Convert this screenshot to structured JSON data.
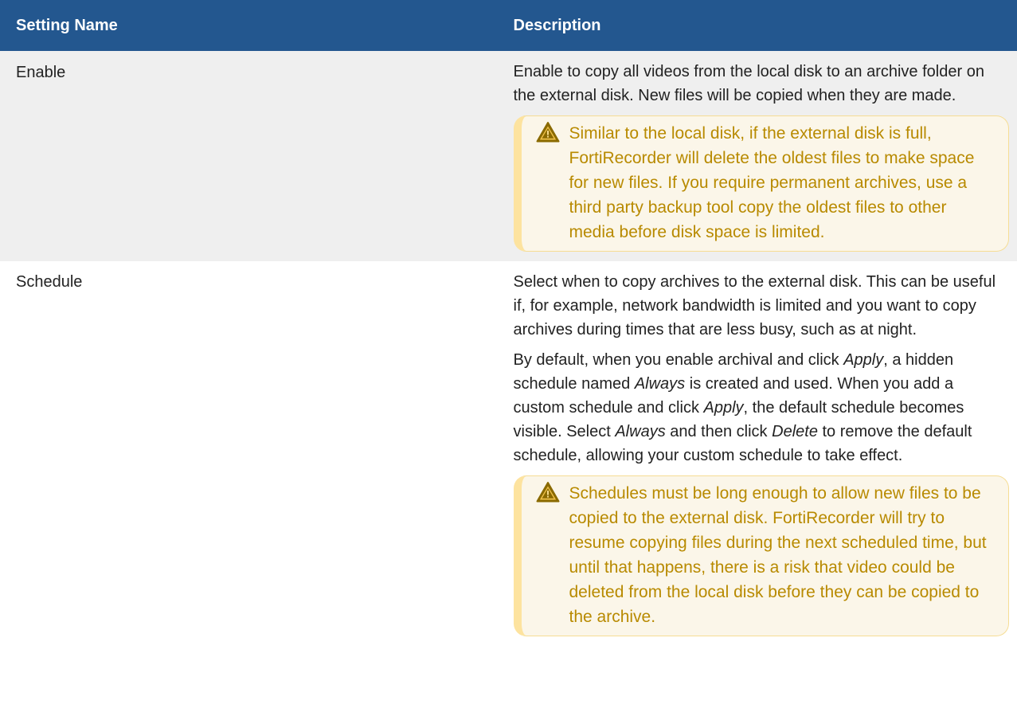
{
  "table": {
    "headers": {
      "setting_name": "Setting Name",
      "description": "Description"
    },
    "rows": [
      {
        "name": "Enable",
        "paragraphs": [
          "Enable to copy all videos from the local disk to an archive folder on the external disk. New files will be copied when they are made."
        ],
        "note": {
          "icon": "warning-icon",
          "text": "Similar to the local disk, if the external disk is full, FortiRecorder will delete the oldest files to make space for new files. If you require permanent archives, use a third party backup tool copy the oldest files to other media before disk space is limited."
        }
      },
      {
        "name": "Schedule",
        "paragraphs": [
          "Select when to copy archives to the external disk. This can be useful if, for example, network bandwidth is limited and you want to copy archives during times that are less busy, such as at night."
        ],
        "default_paragraph": {
          "t1": "By default, when you enable archival and click ",
          "apply1": "Apply",
          "t2": ", a hidden schedule named ",
          "always1": "Always",
          "t3": " is created and used. When you add a custom schedule and click ",
          "apply2": "Apply",
          "t4": ", the default schedule becomes visible. Select ",
          "always2": "Always",
          "t5": " and then click ",
          "delete": "Delete",
          "t6": " to remove the default schedule, allowing your custom schedule to take effect."
        },
        "note": {
          "icon": "warning-icon",
          "text": "Schedules must be long enough to allow new files to be copied to the external disk. FortiRecorder will try to resume copying files during the next scheduled time, but until that happens, there is a risk that video could be deleted from the local disk before they can be copied to the archive."
        }
      }
    ]
  },
  "colors": {
    "header_bg": "#23578f",
    "note_text": "#b88a00",
    "note_border": "#fde39f",
    "row_alt_bg": "#efefef"
  }
}
